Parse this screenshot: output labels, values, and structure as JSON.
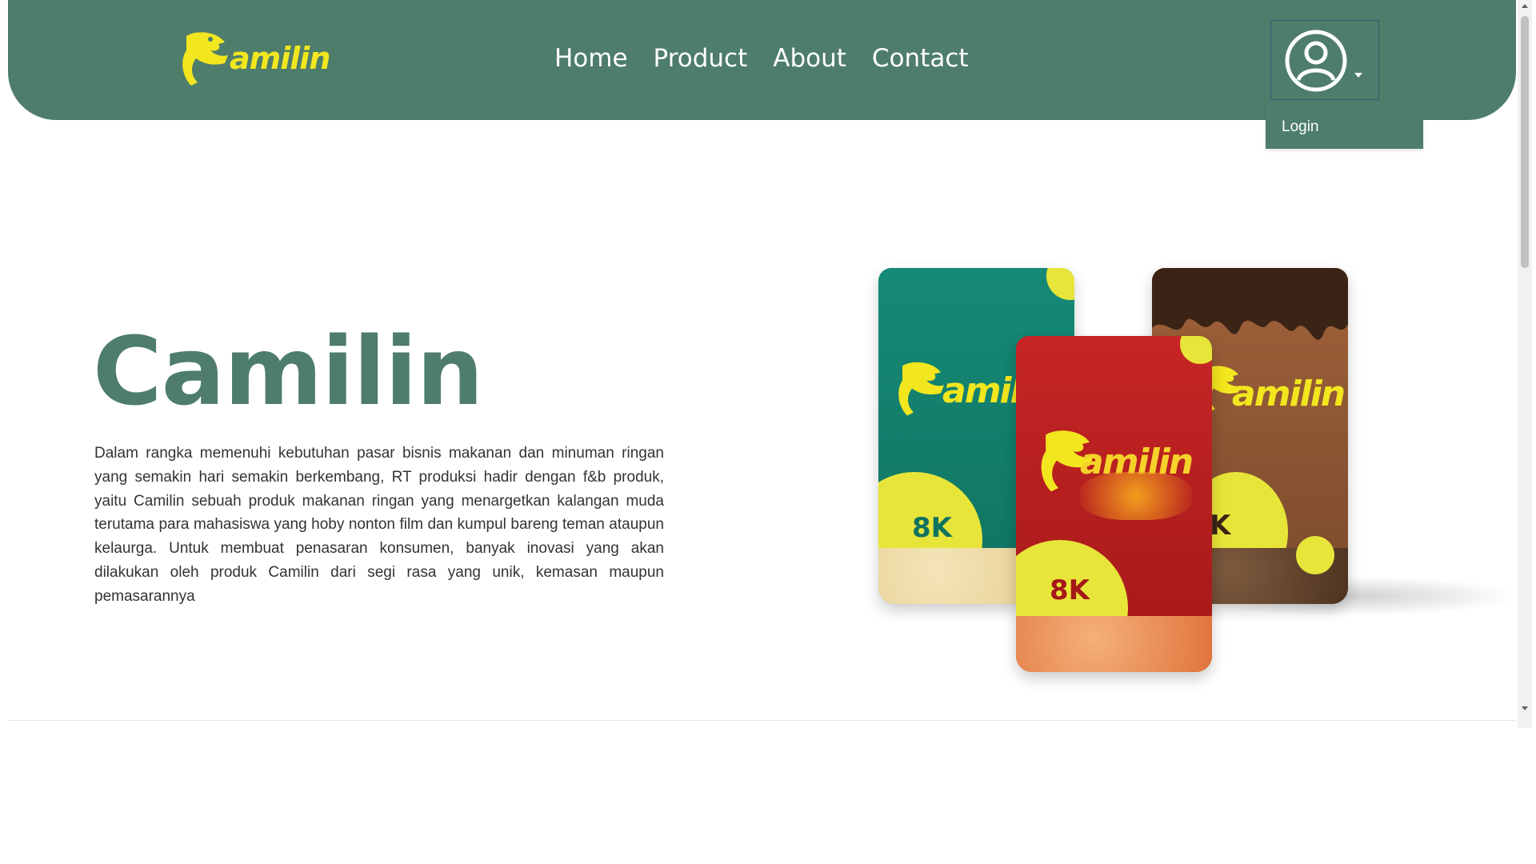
{
  "brand": {
    "logo_text": "amilin",
    "logo_alt": "Camilin logo",
    "color": "#f2e61f"
  },
  "nav": {
    "links": [
      "Home",
      "Product",
      "About",
      "Contact"
    ],
    "background": "#4e7d6b"
  },
  "user_menu": {
    "icon": "user-circle-icon",
    "dropdown_items": [
      "Login"
    ]
  },
  "hero": {
    "title": "Camilin",
    "description": "Dalam rangka memenuhi kebutuhan pasar bisnis makanan dan minuman ringan yang semakin hari semakin berkembang, RT produksi hadir dengan f&b produk, yaitu Camilin sebuah produk makanan ringan yang menargetkan kalangan muda terutama para mahasiswa yang hoby nonton film dan kumpul bareng teman ataupun kelaurga. Untuk membuat penasaran konsumen, banyak inovasi yang akan dilakukan oleh produk Camilin dari segi rasa yang unik, kemasan maupun pemasarannya",
    "title_color": "#4e7d6b"
  },
  "products": {
    "green": {
      "word": "amil",
      "price": "8K"
    },
    "red": {
      "word": "amilin",
      "price": "8K"
    },
    "brown": {
      "word": "amilin",
      "price": "K"
    }
  }
}
